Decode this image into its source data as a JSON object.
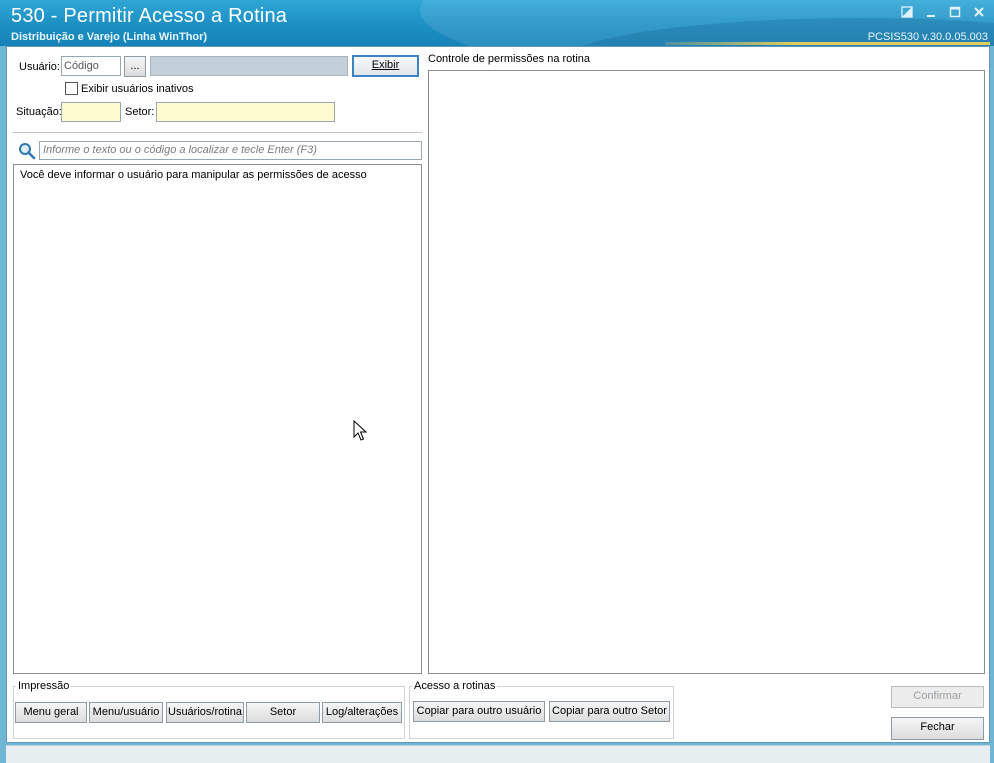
{
  "window": {
    "title": "530 - Permitir Acesso a Rotina",
    "subtitle": "Distribuição e Varejo (Linha WinThor)",
    "version": "PCSIS530  v.30.0.05.003"
  },
  "form": {
    "usuario_label": "Usuário:",
    "usuario_code_value": "Código",
    "lookup_button": "...",
    "usuario_name_value": "",
    "exibir_button": "Exibir",
    "exibir_inativos_label": "Exibir usuários inativos",
    "exibir_inativos_checked": false,
    "situacao_label": "Situação:",
    "situacao_value": "",
    "setor_label": "Setor:",
    "setor_value": ""
  },
  "search": {
    "placeholder": "Informe o texto ou o código a localizar e tecle Enter (F3)"
  },
  "left_panel": {
    "message": "Você deve informar o usuário para manipular as permissões de acesso"
  },
  "right_panel": {
    "title": "Controle de permissões na rotina"
  },
  "impressao": {
    "title": "Impressão",
    "buttons": [
      "Menu geral",
      "Menu/usuário",
      "Usuários/rotina",
      "Setor",
      "Log/alterações"
    ]
  },
  "acesso": {
    "title": "Acesso a rotinas",
    "buttons": [
      "Copiar para outro usuário",
      "Copiar para outro Setor"
    ]
  },
  "actions": {
    "confirmar": "Confirmar",
    "fechar": "Fechar"
  },
  "icons": {
    "search": "search-icon",
    "restore": "restore-icon",
    "minimize": "minimize-icon",
    "maximize": "maximize-icon",
    "close": "close-icon"
  }
}
